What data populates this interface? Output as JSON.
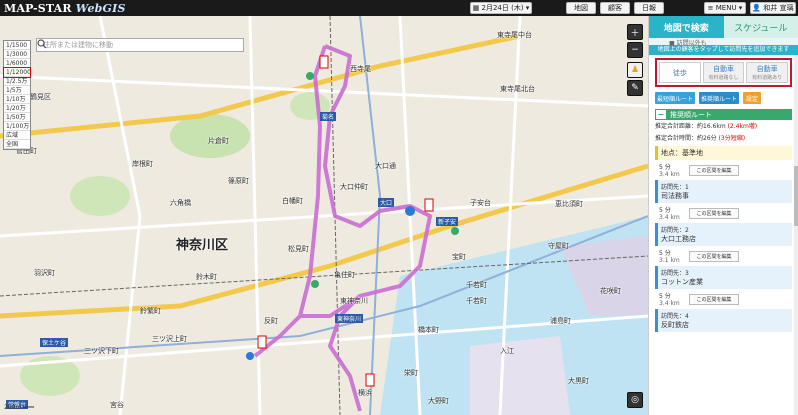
{
  "app": {
    "logo_main": "MAP-STAR ",
    "logo_sub": "WebGIS"
  },
  "topbar": {
    "date_label": "2月24日 (木)",
    "buttons": [
      "地図",
      "顧客",
      "日報"
    ],
    "menu_label": "MENU",
    "user_name": "和井 宣璃"
  },
  "map": {
    "search_placeholder": "住所または建物に移動",
    "zoom_levels": [
      "1/1500",
      "1/3000",
      "1/6000",
      "1/12000",
      "1/2.5万",
      "1/5万",
      "1/10万",
      "1/20万",
      "1/50万",
      "1/100万",
      "広域",
      "全国"
    ],
    "zoom_selected_index": 3,
    "labels": [
      {
        "text": "鶴見区",
        "cls": ""
      },
      {
        "text": "神奈川区",
        "cls": "big"
      },
      {
        "text": "西寺尾",
        "cls": ""
      },
      {
        "text": "東寺尾中台",
        "cls": ""
      },
      {
        "text": "篠原町",
        "cls": ""
      },
      {
        "text": "大口通",
        "cls": ""
      },
      {
        "text": "子安台",
        "cls": ""
      },
      {
        "text": "白幡町",
        "cls": ""
      },
      {
        "text": "六角橋",
        "cls": ""
      },
      {
        "text": "東神奈川",
        "cls": ""
      },
      {
        "text": "反町",
        "cls": ""
      },
      {
        "text": "鈴繁町",
        "cls": ""
      },
      {
        "text": "三ツ沢下町",
        "cls": ""
      },
      {
        "text": "宮谷",
        "cls": ""
      },
      {
        "text": "菅田町",
        "cls": ""
      },
      {
        "text": "岸根町",
        "cls": ""
      },
      {
        "text": "恵比須町",
        "cls": ""
      },
      {
        "text": "守屋町",
        "cls": ""
      },
      {
        "text": "千若町",
        "cls": ""
      },
      {
        "text": "橋本町",
        "cls": ""
      },
      {
        "text": "大黒町",
        "cls": ""
      },
      {
        "text": "東寺尾北台",
        "cls": ""
      },
      {
        "text": "大口仲町",
        "cls": ""
      },
      {
        "text": "松見町",
        "cls": ""
      },
      {
        "text": "浦島町",
        "cls": ""
      },
      {
        "text": "亀住町",
        "cls": ""
      },
      {
        "text": "新子安",
        "cls": "sta"
      },
      {
        "text": "大口",
        "cls": "sta"
      },
      {
        "text": "東神奈川",
        "cls": "sta"
      },
      {
        "text": "保土ケ谷",
        "cls": "sta"
      },
      {
        "text": "菊名",
        "cls": "sta"
      },
      {
        "text": "常盤台",
        "cls": "sta"
      },
      {
        "text": "横浜",
        "cls": ""
      },
      {
        "text": "鈴木町",
        "cls": ""
      },
      {
        "text": "三ツ沢上町",
        "cls": ""
      },
      {
        "text": "羽沢町",
        "cls": ""
      },
      {
        "text": "片倉町",
        "cls": ""
      },
      {
        "text": "大野町",
        "cls": ""
      },
      {
        "text": "宝町",
        "cls": ""
      },
      {
        "text": "入江",
        "cls": ""
      },
      {
        "text": "千若町",
        "cls": ""
      },
      {
        "text": "栄町",
        "cls": ""
      },
      {
        "text": "花咲町",
        "cls": ""
      }
    ],
    "scale_text": "200m"
  },
  "panel": {
    "tab_active": "地図で検索",
    "tab_inactive": "スケジュール",
    "sub_strip": "■ 訪問以外も",
    "hint": "地図上の顧客をタップして訪問先を追加できます",
    "modes": [
      {
        "label": "徒歩",
        "sub": ""
      },
      {
        "label": "自動車",
        "sub": "有料道路なし"
      },
      {
        "label": "自動車",
        "sub": "有料道路あり"
      }
    ],
    "route_buttons": [
      "最短順ルート",
      "推奨順ルート",
      "設定"
    ],
    "section_title": "推奨順ルート",
    "total_distance_prefix": "推定合計距離：約16.6km ",
    "total_distance_delta": "(2.4km増)",
    "total_time_prefix": "推定合計時間：約26分 ",
    "total_time_delta": "(3分短縮)",
    "start_title": "地点：基準地",
    "comment_button": "この区間を編集",
    "stops": [
      {
        "leg_time": "5 分",
        "leg_dist": "3.4 km",
        "visit": "訪問先：1",
        "name": "司法務事"
      },
      {
        "leg_time": "5 分",
        "leg_dist": "3.4 km",
        "visit": "訪問先：2",
        "name": "大口工務店"
      },
      {
        "leg_time": "5 分",
        "leg_dist": "3.1 km",
        "visit": "訪問先：3",
        "name": "コットン産業"
      },
      {
        "leg_time": "5 分",
        "leg_dist": "3.4 km",
        "visit": "訪問先：4",
        "name": "反町鉄店"
      }
    ]
  },
  "colors": {
    "route": "#c96ed1",
    "accent": "#2ab4c9",
    "section": "#39a86c",
    "highlight": "#c0192f"
  }
}
